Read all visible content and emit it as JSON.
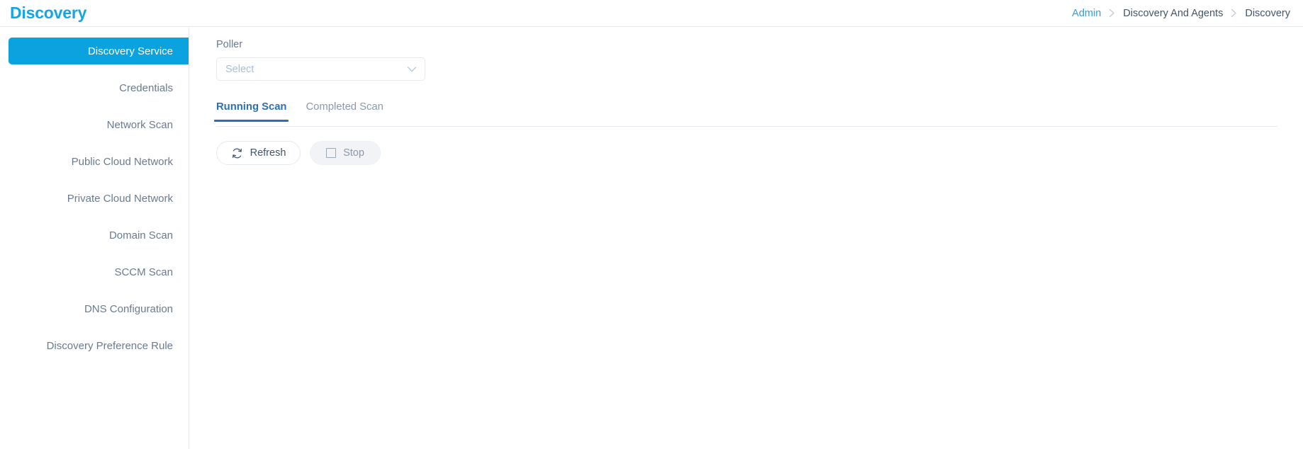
{
  "header": {
    "title": "Discovery",
    "breadcrumb": [
      {
        "label": "Admin",
        "type": "link"
      },
      {
        "label": "Discovery And Agents",
        "type": "plain"
      },
      {
        "label": "Discovery",
        "type": "plain"
      }
    ],
    "separator_icon": "chevron-right-icon"
  },
  "sidebar": {
    "items": [
      {
        "label": "Discovery Service",
        "active": true
      },
      {
        "label": "Credentials",
        "active": false
      },
      {
        "label": "Network Scan",
        "active": false
      },
      {
        "label": "Public Cloud Network",
        "active": false
      },
      {
        "label": "Private Cloud Network",
        "active": false
      },
      {
        "label": "Domain Scan",
        "active": false
      },
      {
        "label": "SCCM Scan",
        "active": false
      },
      {
        "label": "DNS Configuration",
        "active": false
      },
      {
        "label": "Discovery Preference Rule",
        "active": false
      }
    ]
  },
  "main": {
    "poller": {
      "label": "Poller",
      "placeholder": "Select",
      "value": "",
      "chevron_icon": "chevron-down-icon"
    },
    "tabs": [
      {
        "label": "Running Scan",
        "active": true
      },
      {
        "label": "Completed Scan",
        "active": false
      }
    ],
    "buttons": {
      "refresh": {
        "label": "Refresh",
        "icon": "refresh-icon"
      },
      "stop": {
        "label": "Stop",
        "icon": "stop-square-icon",
        "disabled": true
      }
    }
  },
  "colors": {
    "brand_blue": "#0ba2e0",
    "title_blue": "#15a5e5",
    "tab_active_blue": "#2c6fb5",
    "link_blue": "#2e9fe0",
    "text_muted": "#6b7b8f",
    "border": "#e3e8ef"
  }
}
